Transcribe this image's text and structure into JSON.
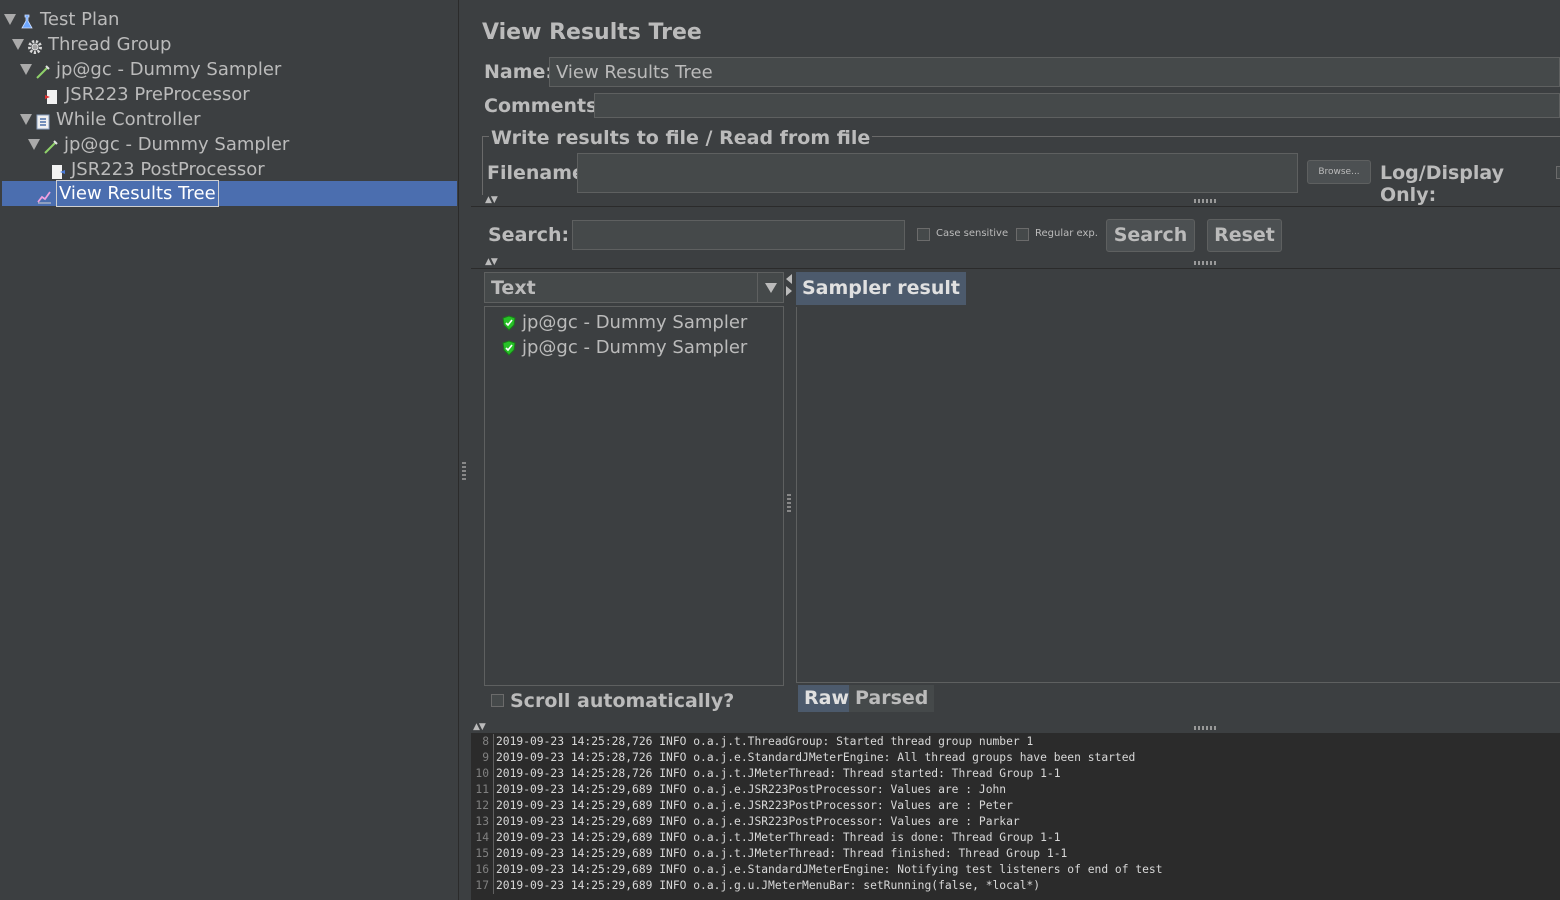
{
  "tree": {
    "nodes": [
      {
        "label": "Test Plan",
        "icon": "flask-icon"
      },
      {
        "label": "Thread Group",
        "icon": "gear-icon"
      },
      {
        "label": "jp@gc - Dummy Sampler",
        "icon": "pipette-icon"
      },
      {
        "label": "JSR223 PreProcessor",
        "icon": "script-icon"
      },
      {
        "label": "While Controller",
        "icon": "controller-icon"
      },
      {
        "label": "jp@gc - Dummy Sampler",
        "icon": "pipette-icon"
      },
      {
        "label": "JSR223 PostProcessor",
        "icon": "script-icon"
      },
      {
        "label": "View Results Tree",
        "icon": "chart-icon"
      }
    ],
    "selected_index": 7
  },
  "panel": {
    "title": "View Results Tree",
    "name_label": "Name:",
    "name_value": "View Results Tree",
    "comments_label": "Comments:",
    "comments_value": "",
    "file_group_title": "Write results to file / Read from file",
    "filename_label": "Filename",
    "filename_value": "",
    "browse_label": "Browse...",
    "log_display_label": "Log/Display Only:"
  },
  "search": {
    "label": "Search:",
    "value": "",
    "case_sensitive_label": "Case sensitive",
    "regex_label": "Regular exp.",
    "search_button": "Search",
    "reset_button": "Reset"
  },
  "results": {
    "renderer_selected": "Text",
    "items": [
      {
        "label": "jp@gc - Dummy Sampler",
        "status": "success"
      },
      {
        "label": "jp@gc - Dummy Sampler",
        "status": "success"
      }
    ],
    "scroll_auto_label": "Scroll automatically?",
    "tab_sampler_result": "Sampler result",
    "tab_raw": "Raw",
    "tab_parsed": "Parsed"
  },
  "log": {
    "lines": [
      {
        "n": "8",
        "text": "2019-09-23 14:25:28,726 INFO o.a.j.t.ThreadGroup: Started thread group number 1"
      },
      {
        "n": "9",
        "text": "2019-09-23 14:25:28,726 INFO o.a.j.e.StandardJMeterEngine: All thread groups have been started"
      },
      {
        "n": "10",
        "text": "2019-09-23 14:25:28,726 INFO o.a.j.t.JMeterThread: Thread started: Thread Group 1-1"
      },
      {
        "n": "11",
        "text": "2019-09-23 14:25:29,689 INFO o.a.j.e.JSR223PostProcessor: Values are : John"
      },
      {
        "n": "12",
        "text": "2019-09-23 14:25:29,689 INFO o.a.j.e.JSR223PostProcessor: Values are : Peter"
      },
      {
        "n": "13",
        "text": "2019-09-23 14:25:29,689 INFO o.a.j.e.JSR223PostProcessor: Values are : Parkar"
      },
      {
        "n": "14",
        "text": "2019-09-23 14:25:29,689 INFO o.a.j.t.JMeterThread: Thread is done: Thread Group 1-1"
      },
      {
        "n": "15",
        "text": "2019-09-23 14:25:29,689 INFO o.a.j.t.JMeterThread: Thread finished: Thread Group 1-1"
      },
      {
        "n": "16",
        "text": "2019-09-23 14:25:29,689 INFO o.a.j.e.StandardJMeterEngine: Notifying test listeners of end of test"
      },
      {
        "n": "17",
        "text": "2019-09-23 14:25:29,689 INFO o.a.j.g.u.JMeterMenuBar: setRunning(false, *local*)"
      }
    ]
  },
  "colors": {
    "background": "#3c3f41",
    "selection": "#4b6eaf",
    "log_background": "#2b2b2b",
    "success_green": "#27c127"
  }
}
